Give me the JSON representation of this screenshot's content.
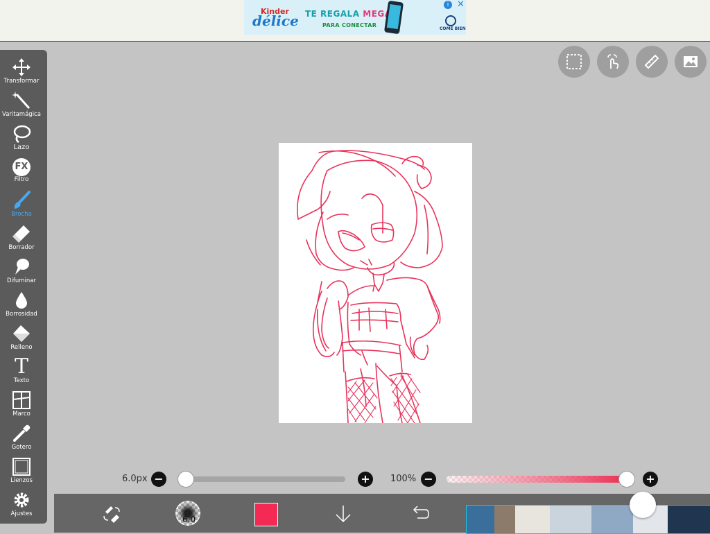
{
  "ad": {
    "brand_small": "Kinder",
    "brand_large": "délice",
    "headline_pre": "TE REGALA ",
    "headline_bold": "MEGAS",
    "subline": "PARA CONECTAR",
    "sponsor": "COME BIEN",
    "close_label": "✕",
    "info_label": "i"
  },
  "toolbar": {
    "items": [
      {
        "label": "Transformar",
        "icon": "move-icon"
      },
      {
        "label": "Varitamágica",
        "icon": "magic-wand-icon"
      },
      {
        "label": "Lazo",
        "icon": "lasso-icon"
      },
      {
        "label": "Filtro",
        "icon": "fx-icon",
        "icon_text": "FX"
      },
      {
        "label": "Brocha",
        "icon": "brush-icon",
        "active": true
      },
      {
        "label": "Borrador",
        "icon": "eraser-icon"
      },
      {
        "label": "Difuminar",
        "icon": "smudge-icon"
      },
      {
        "label": "Borrosidad",
        "icon": "blur-drop-icon"
      },
      {
        "label": "Relleno",
        "icon": "fill-bucket-icon"
      },
      {
        "label": "Texto",
        "icon": "text-icon",
        "icon_text": "T"
      },
      {
        "label": "Marco",
        "icon": "frame-icon"
      },
      {
        "label": "Gotero",
        "icon": "eyedropper-icon"
      },
      {
        "label": "Lienzos",
        "icon": "canvas-icon"
      },
      {
        "label": "Ajustes",
        "icon": "gear-icon"
      }
    ],
    "active_color": "#48a8f0"
  },
  "top_actions": [
    "selection-icon",
    "touch-gesture-icon",
    "ruler-icon",
    "image-icon"
  ],
  "brush_size": {
    "value_label": "6.0px",
    "value": 6.0,
    "level": 0.0
  },
  "opacity": {
    "value_label": "100%",
    "value": 100
  },
  "bottom_bar": {
    "brush_preview_label": "6.0",
    "current_color": "#f42a55"
  },
  "colors": {
    "toolbar_bg": "#5b5b5b",
    "workspace_bg": "#c4c4c4",
    "stroke": "#e8335c"
  }
}
